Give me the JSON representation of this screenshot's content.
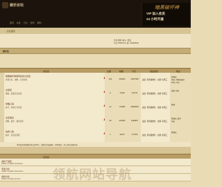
{
  "header": {
    "site_title": "娱乐论坛",
    "menu": [
      "首页",
      "社区",
      "日记",
      "搜索",
      "帮助"
    ]
  },
  "banner": {
    "logo": "暗黑破坏神",
    "line1": "VIP 加入会员",
    "line2": "24 小时开通"
  },
  "breadcrumb": "→ 论坛首页",
  "stats": {
    "line1": "共有主题 / 帖子 / 会员",
    "line2": "今日: 8846714 | 总: 319409003"
  },
  "category": {
    "label": "娱乐区"
  },
  "columns": {
    "forum": "论坛名",
    "topics": "主题",
    "posts": "帖数",
    "today": "今日",
    "last": "最后发表",
    "mods": "版主"
  },
  "forums": [
    {
      "name": "暗黑破坏神游戏综合讨论区",
      "desc": "游戏讨论、攻略、心得交流",
      "topics": "120",
      "posts": "364023",
      "today": "11267558",
      "last": "发表: 晕的我想吐 . 主题: 星期三",
      "mods": [
        "管理员",
        "你说, 可能是这样",
        "Ruby, 可以"
      ]
    },
    {
      "name": "交易区",
      "desc": "物品、装备买卖交流",
      "topics": "0",
      "posts": "17299",
      "today": "167471",
      "last": "发表: 晕的我想吐 . 主题: 星期三",
      "mods": [
        "暗黑, 你好"
      ]
    },
    {
      "name": "攻略心得",
      "desc": "技巧、经验分享交流",
      "topics": "14",
      "posts": "779966",
      "today": "19893993",
      "last": "发表: 晕的我想吐 . 主题: 星期三",
      "mods": [
        "管理"
      ]
    },
    {
      "name": "水区灌水",
      "desc": "闲聊、娱乐、灌水专区",
      "topics": "28",
      "posts": "323466",
      "today": "6190907",
      "last": "发表: 晕的我想吐 . 主题: 星期三",
      "mods": [
        "管理员, 版主",
        "站长"
      ]
    },
    {
      "name": "站务公告",
      "desc": "站务、意见反馈区",
      "topics": "1",
      "posts": "32273",
      "today": "177260",
      "last": "发表: 晕的我想吐 . 主题: 星期三",
      "mods": [
        "管理员"
      ]
    }
  ],
  "notice": "本论坛为游戏爱好者交流平台，请遵守论坛规则，文明发帖，禁止发布违规内容。",
  "section2": {
    "columns": {
      "forum": "论坛名"
    },
    "forums": [
      {
        "name": "资料下载区",
        "desc": "Diablo II Ladder Download"
      },
      {
        "name": "专区讨论",
        "desc": "Diablo II Ladder Discussion"
      },
      {
        "name": "资料讨论",
        "desc": "Diablo II Ladder Archive"
      }
    ]
  },
  "watermark": "领航网站导航"
}
